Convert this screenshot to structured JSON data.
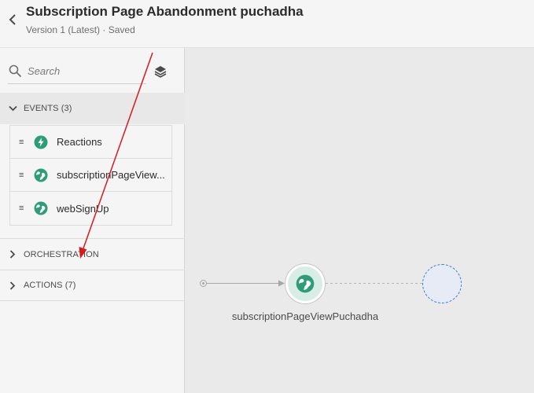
{
  "header": {
    "title": "Subscription Page Abandonment puchadha",
    "version_status": "Version 1 (Latest) · Saved"
  },
  "sidebar": {
    "search": {
      "placeholder": "Search",
      "value": ""
    },
    "sections": {
      "events": {
        "label": "EVENTS (3)",
        "expanded": true
      },
      "orchestration": {
        "label": "ORCHESTRATION",
        "expanded": false
      },
      "actions": {
        "label": "ACTIONS (7)",
        "expanded": false
      }
    },
    "events": [
      {
        "label": "Reactions",
        "icon": "lightning-icon"
      },
      {
        "label": "subscriptionPageView...",
        "icon": "globe-icon"
      },
      {
        "label": "webSignUp",
        "icon": "globe-icon"
      }
    ]
  },
  "canvas": {
    "node_label": "subscriptionPageViewPuchadha"
  },
  "colors": {
    "event_icon": "#2d9d78",
    "annotation_arrow": "#d7191c",
    "placeholder_border": "#3a7cd6"
  }
}
